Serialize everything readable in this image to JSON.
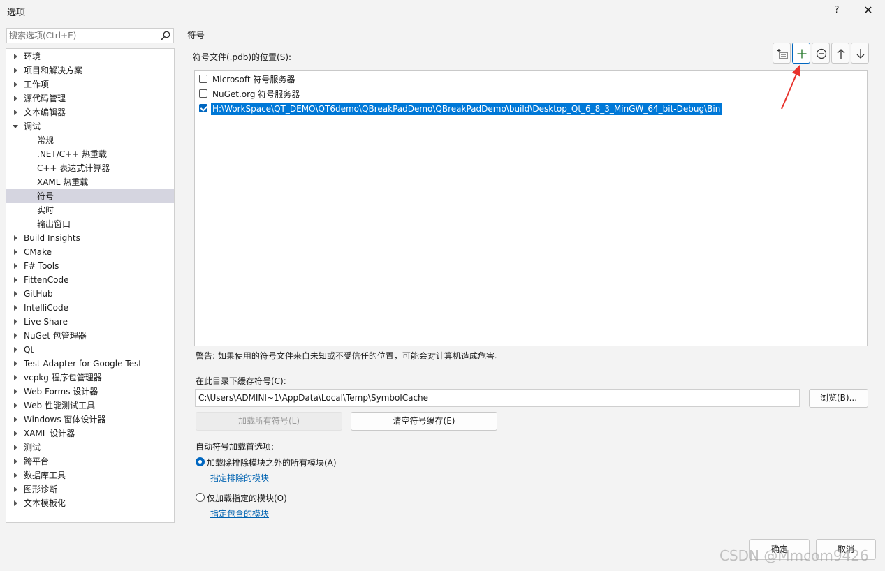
{
  "window": {
    "title": "选项",
    "help": "?",
    "close": "✕"
  },
  "search": {
    "placeholder": "搜索选项(Ctrl+E)"
  },
  "tree": [
    {
      "label": "环境",
      "expand": "closed",
      "indent": 0
    },
    {
      "label": "项目和解决方案",
      "expand": "closed",
      "indent": 0
    },
    {
      "label": "工作项",
      "expand": "closed",
      "indent": 0
    },
    {
      "label": "源代码管理",
      "expand": "closed",
      "indent": 0
    },
    {
      "label": "文本编辑器",
      "expand": "closed",
      "indent": 0
    },
    {
      "label": "调试",
      "expand": "open",
      "indent": 0
    },
    {
      "label": "常规",
      "expand": "none",
      "indent": 1
    },
    {
      "label": ".NET/C++ 热重载",
      "expand": "none",
      "indent": 1
    },
    {
      "label": "C++ 表达式计算器",
      "expand": "none",
      "indent": 1
    },
    {
      "label": "XAML 热重载",
      "expand": "none",
      "indent": 1
    },
    {
      "label": "符号",
      "expand": "none",
      "indent": 1,
      "selected": true
    },
    {
      "label": "实时",
      "expand": "none",
      "indent": 1
    },
    {
      "label": "输出窗口",
      "expand": "none",
      "indent": 1
    },
    {
      "label": "Build Insights",
      "expand": "closed",
      "indent": 0
    },
    {
      "label": "CMake",
      "expand": "closed",
      "indent": 0
    },
    {
      "label": "F# Tools",
      "expand": "closed",
      "indent": 0
    },
    {
      "label": "FittenCode",
      "expand": "closed",
      "indent": 0
    },
    {
      "label": "GitHub",
      "expand": "closed",
      "indent": 0
    },
    {
      "label": "IntelliCode",
      "expand": "closed",
      "indent": 0
    },
    {
      "label": "Live Share",
      "expand": "closed",
      "indent": 0
    },
    {
      "label": "NuGet 包管理器",
      "expand": "closed",
      "indent": 0
    },
    {
      "label": "Qt",
      "expand": "closed",
      "indent": 0
    },
    {
      "label": "Test Adapter for Google Test",
      "expand": "closed",
      "indent": 0
    },
    {
      "label": "vcpkg 程序包管理器",
      "expand": "closed",
      "indent": 0
    },
    {
      "label": "Web Forms 设计器",
      "expand": "closed",
      "indent": 0
    },
    {
      "label": "Web 性能测试工具",
      "expand": "closed",
      "indent": 0
    },
    {
      "label": "Windows 窗体设计器",
      "expand": "closed",
      "indent": 0
    },
    {
      "label": "XAML 设计器",
      "expand": "closed",
      "indent": 0
    },
    {
      "label": "测试",
      "expand": "closed",
      "indent": 0
    },
    {
      "label": "跨平台",
      "expand": "closed",
      "indent": 0
    },
    {
      "label": "数据库工具",
      "expand": "closed",
      "indent": 0
    },
    {
      "label": "图形诊断",
      "expand": "closed",
      "indent": 0
    },
    {
      "label": "文本模板化",
      "expand": "closed",
      "indent": 0
    }
  ],
  "section": {
    "title": "符号",
    "locations_label": "符号文件(.pdb)的位置(S):"
  },
  "toolbar": {
    "buttons": [
      {
        "icon": "add-folder-icon"
      },
      {
        "icon": "plus-icon",
        "active": true
      },
      {
        "icon": "minus-circle-icon"
      },
      {
        "icon": "arrow-up-icon"
      },
      {
        "icon": "arrow-down-icon"
      }
    ]
  },
  "locations": [
    {
      "label": "Microsoft 符号服务器",
      "checked": false,
      "selected": false
    },
    {
      "label": "NuGet.org 符号服务器",
      "checked": false,
      "selected": false
    },
    {
      "label": "H:\\WorkSpace\\QT_DEMO\\QT6demo\\QBreakPadDemo\\QBreakPadDemo\\build\\Desktop_Qt_6_8_3_MinGW_64_bit-Debug\\Bin",
      "checked": true,
      "selected": true
    }
  ],
  "warning": "警告: 如果使用的符号文件来自未知或不受信任的位置，可能会对计算机造成危害。",
  "cache": {
    "label": "在此目录下缓存符号(C):",
    "value": "C:\\Users\\ADMINI~1\\AppData\\Local\\Temp\\SymbolCache",
    "browse": "浏览(B)...",
    "load_all": "加载所有符号(L)",
    "clear": "清空符号缓存(E)"
  },
  "auto_load": {
    "label": "自动符号加载首选项:",
    "option1": "加载除排除模块之外的所有模块(A)",
    "option1_link": "指定排除的模块",
    "option2": "仅加载指定的模块(O)",
    "option2_link": "指定包含的模块",
    "selected": 1
  },
  "footer": {
    "ok": "确定",
    "cancel": "取消"
  },
  "watermark": "CSDN @Mmcom9426",
  "colors": {
    "accent": "#0067c0",
    "selection": "#0078d7",
    "tree_selection": "#d5d5e0",
    "annotation": "#e8322c"
  }
}
